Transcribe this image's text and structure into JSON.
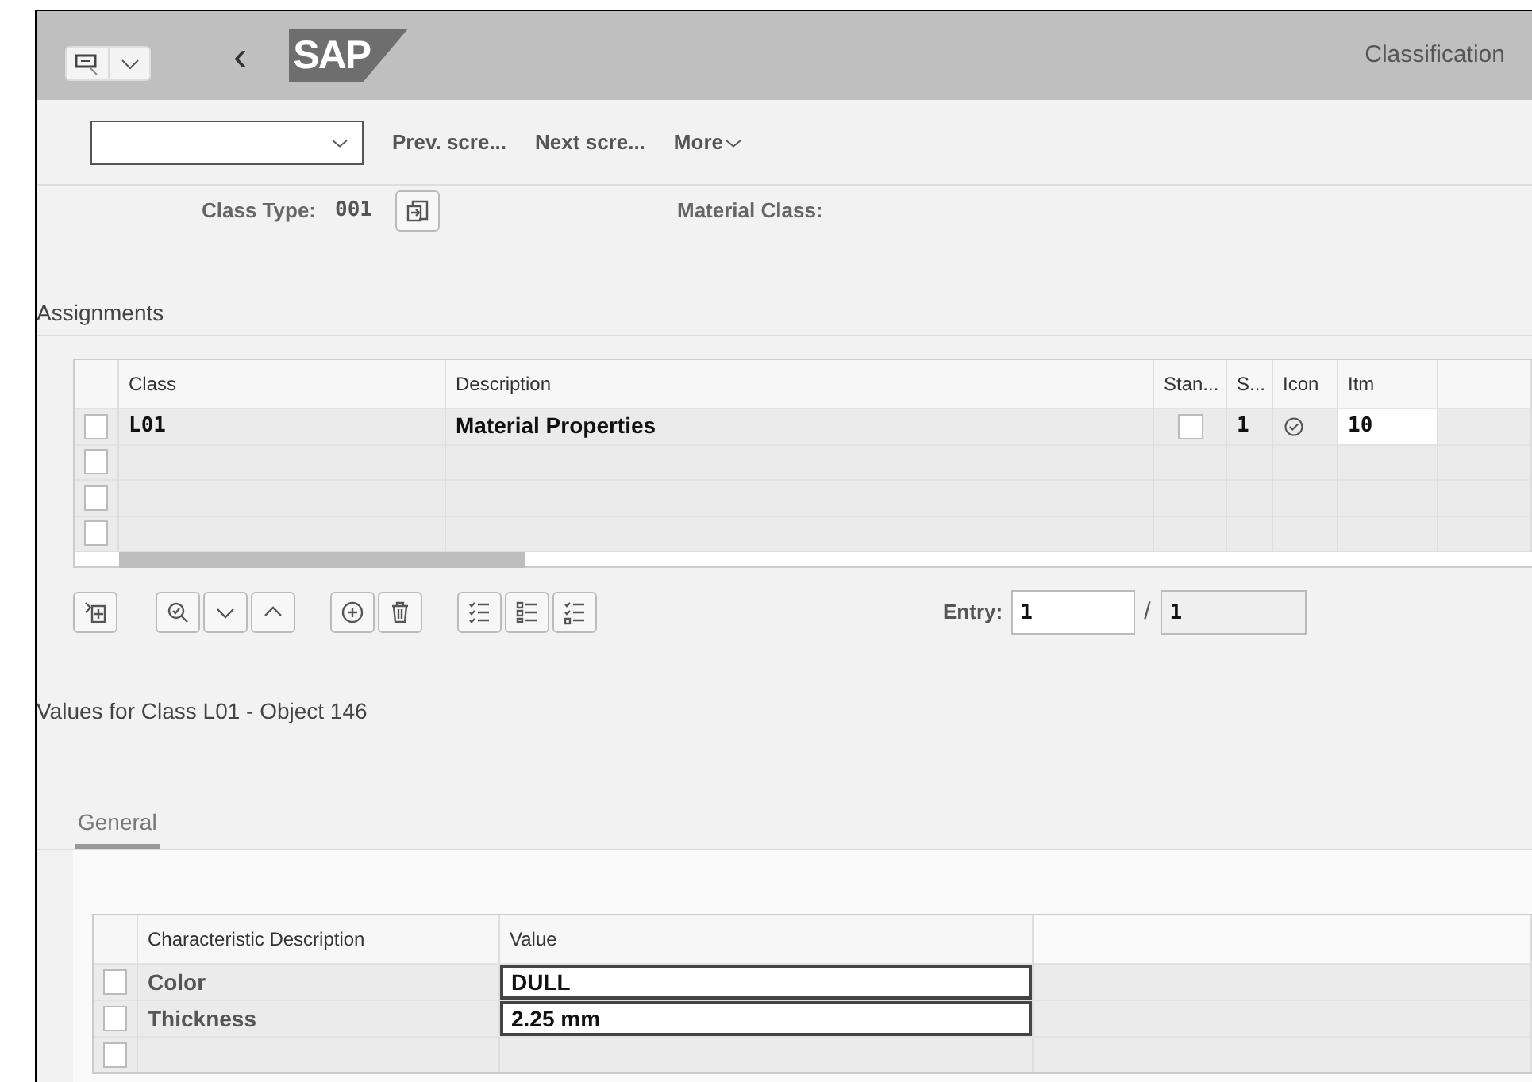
{
  "header": {
    "back": "‹",
    "logo": "SAP",
    "title": "Classification"
  },
  "toolbar": {
    "command_field": {
      "kind": "combo"
    },
    "buttons": [
      "Prev. scre...",
      "Next scre...",
      "More"
    ]
  },
  "class_type": {
    "label": "Class Type:",
    "value": "001",
    "material_class_label": "Material Class:"
  },
  "assignments": {
    "title": "Assignments",
    "columns": [
      "Class",
      "Description",
      "Stan...",
      "S...",
      "Icon",
      "Itm"
    ],
    "rows": [
      {
        "kind": "entry",
        "selected": false,
        "class": "L01",
        "description": "Material Properties",
        "standard": false,
        "s": "1",
        "status_ok": true,
        "itm": "10"
      },
      {
        "kind": "blank",
        "selected": false
      },
      {
        "kind": "blank",
        "selected": false
      },
      {
        "kind": "blank",
        "selected": false
      }
    ],
    "entry": {
      "label": "Entry:",
      "current": "1",
      "separator": "/",
      "total": "1"
    }
  },
  "values": {
    "title": "Values for Class L01 - Object 146",
    "tabs": [
      {
        "label": "General",
        "selected": true
      }
    ],
    "columns": [
      "Characteristic Description",
      "Value"
    ],
    "rows": [
      {
        "kind": "entry",
        "selected": false,
        "description": "Color",
        "value": "DULL"
      },
      {
        "kind": "entry",
        "selected": false,
        "description": "Thickness",
        "value": "2.25 mm"
      },
      {
        "kind": "blank",
        "selected": false
      }
    ]
  }
}
